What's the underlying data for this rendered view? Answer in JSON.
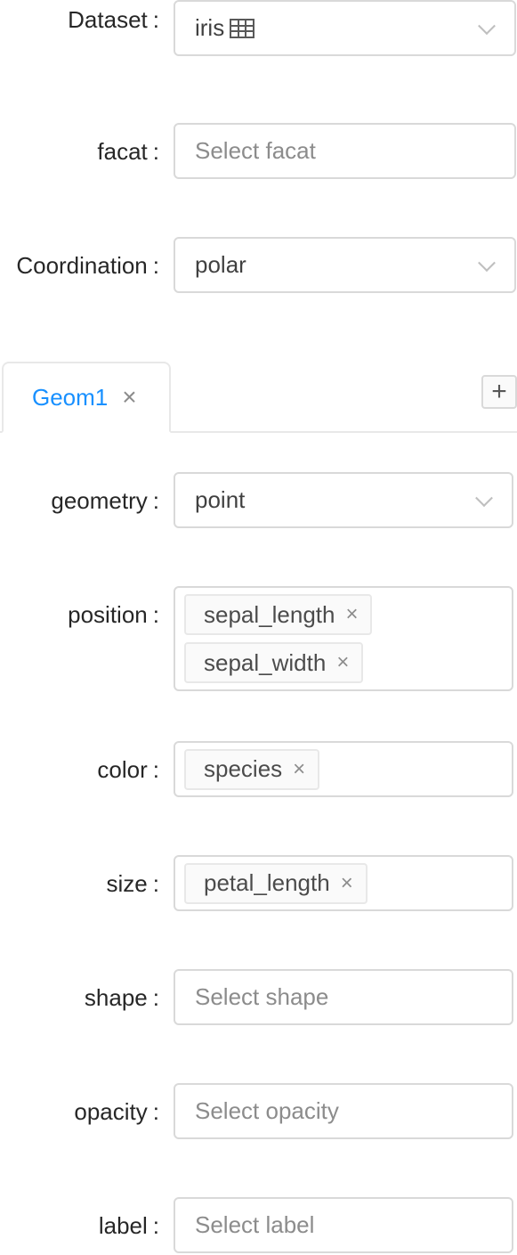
{
  "top_form": {
    "dataset": {
      "label": "Dataset",
      "value": "iris"
    },
    "facat": {
      "label": "facat",
      "placeholder": "Select facat"
    },
    "coordination": {
      "label": "Coordination",
      "value": "polar"
    }
  },
  "tabs": {
    "items": [
      {
        "label": "Geom1"
      }
    ],
    "close_symbol": "×",
    "add_symbol": "+"
  },
  "geom_form": {
    "geometry": {
      "label": "geometry",
      "value": "point"
    },
    "position": {
      "label": "position",
      "tags": [
        "sepal_length",
        "sepal_width"
      ]
    },
    "color": {
      "label": "color",
      "tags": [
        "species"
      ]
    },
    "size": {
      "label": "size",
      "tags": [
        "petal_length"
      ]
    },
    "shape": {
      "label": "shape",
      "placeholder": "Select shape"
    },
    "opacity": {
      "label": "opacity",
      "placeholder": "Select opacity"
    },
    "label": {
      "label": "label",
      "placeholder": "Select label"
    }
  },
  "colon": ":",
  "tag_close_symbol": "×",
  "colors": {
    "accent": "#1890ff",
    "border": "#d9d9d9",
    "placeholder": "#8c8c8c"
  }
}
